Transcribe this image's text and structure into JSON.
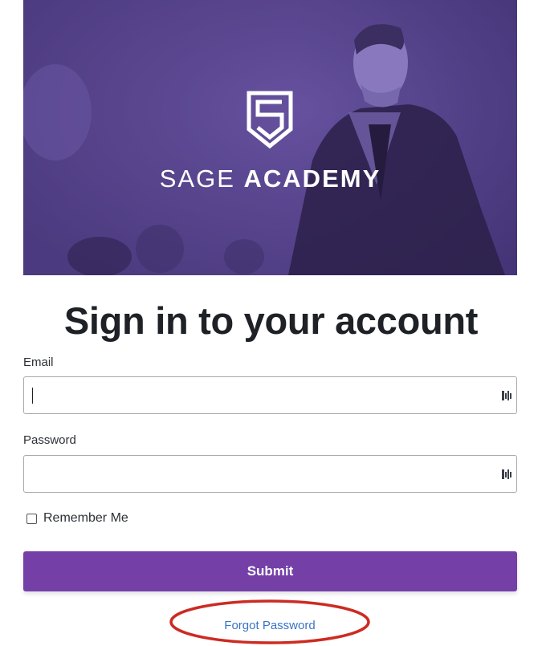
{
  "hero": {
    "brand_light": "SAGE ",
    "brand_bold": "ACADEMY",
    "logo_icon": "shield-s-logo-icon"
  },
  "title": "Sign in to your account",
  "email": {
    "label": "Email",
    "value": "",
    "icon": "password-manager-icon"
  },
  "password": {
    "label": "Password",
    "value": "",
    "icon": "password-manager-icon"
  },
  "remember": {
    "label": "Remember Me",
    "checked": false
  },
  "submit_label": "Submit",
  "forgot_label": "Forgot Password",
  "colors": {
    "accent": "#7440a8",
    "hero_overlay": "#5b4691",
    "link": "#3b73c6",
    "annotation": "#cc2b22"
  }
}
